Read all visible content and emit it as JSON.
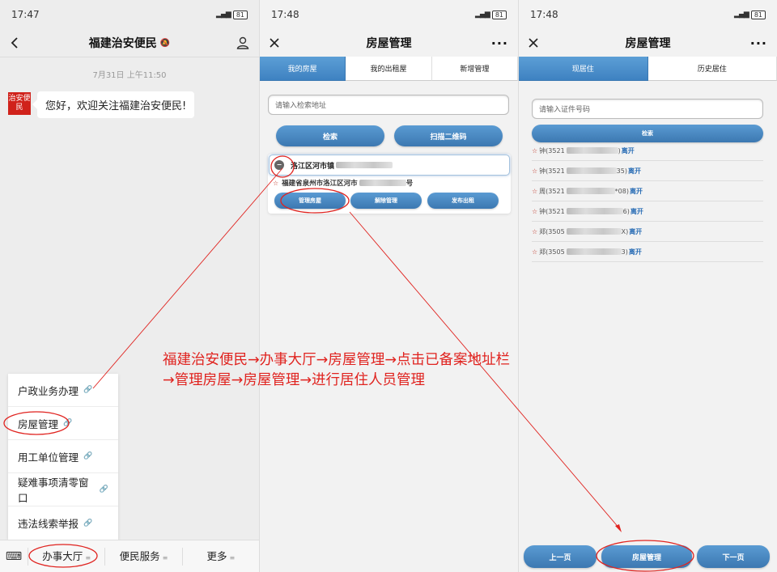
{
  "status_bar": {
    "p1_time": "17:47",
    "p2_time": "17:48",
    "p3_time": "17:48",
    "battery": "81"
  },
  "panel1": {
    "title": "福建治安便民",
    "chat_time": "7月31日 上午11:50",
    "avatar_text": "治安便民",
    "welcome_message": "您好，欢迎关注福建治安便民!",
    "popup_menu": [
      "户政业务办理",
      "房屋管理",
      "用工单位管理",
      "疑难事项清零窗口",
      "违法线索举报"
    ],
    "menu_bar": [
      "办事大厅",
      "便民服务",
      "更多"
    ]
  },
  "panel2": {
    "title": "房屋管理",
    "tabs": [
      "我的房屋",
      "我的出租屋",
      "新增管理"
    ],
    "search_placeholder": "请输入检索地址",
    "search_button": "检索",
    "scan_button": "扫描二维码",
    "house_address_short": "洛江区河市镇",
    "house_address_full": "福建省泉州市洛江区河市",
    "house_address_suffix": "号",
    "card_buttons": [
      "管理房屋",
      "解除管理",
      "发布出租"
    ]
  },
  "panel3": {
    "title": "房屋管理",
    "tabs": [
      "现居住",
      "历史居住"
    ],
    "id_placeholder": "请输入证件号码",
    "search_button": "检索",
    "residents": [
      {
        "name": "钟",
        "id_start": "(3521",
        "id_end": ")",
        "action": "离开"
      },
      {
        "name": "钟",
        "id_start": "(3521",
        "id_end": "35)",
        "action": "离开"
      },
      {
        "name": "周",
        "id_start": "(3521",
        "id_end": "*08)",
        "action": "离开"
      },
      {
        "name": "钟",
        "id_start": "(3521",
        "id_end": "6)",
        "action": "离开"
      },
      {
        "name": "郑",
        "id_start": "(3505",
        "id_end": "X)",
        "action": "离开"
      },
      {
        "name": "郑",
        "id_start": "(3505",
        "id_end": "3)",
        "action": "离开"
      }
    ],
    "bottom_buttons": [
      "上一页",
      "房屋管理",
      "下一页"
    ]
  },
  "annotation": {
    "line1": "福建治安便民→办事大厅→房屋管理→点击已备案地址栏",
    "line2": "→管理房屋→房屋管理→进行居住人员管理"
  },
  "colors": {
    "accent_blue": "#3e82c1",
    "annotation_red": "#e0231f",
    "leave_link": "#2a6db5"
  }
}
